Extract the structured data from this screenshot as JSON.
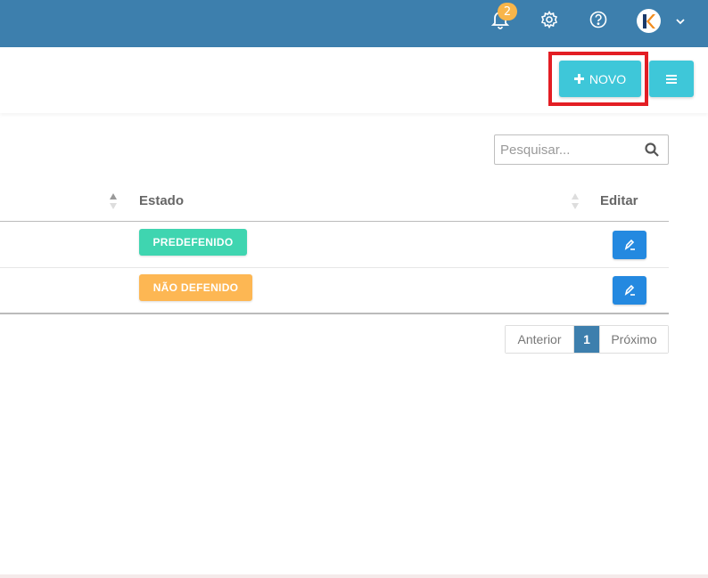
{
  "topbar": {
    "notifications_count": "2",
    "icons": [
      "bell-icon",
      "gear-icon",
      "help-icon",
      "chevron-down-icon"
    ],
    "avatar_letter": "K"
  },
  "toolbar": {
    "new_label": "NOVO",
    "new_icon": "plus-icon",
    "menu_icon": "hamburger-icon"
  },
  "search": {
    "placeholder": "Pesquisar..."
  },
  "table": {
    "columns": [
      "Estado",
      "Editar"
    ],
    "rows": [
      {
        "status": "PREDEFENIDO",
        "status_color": "#3fd5b0"
      },
      {
        "status": "NÃO DEFENIDO",
        "status_color": "#fdb753"
      }
    ]
  },
  "pagination": {
    "prev": "Anterior",
    "current": "1",
    "next": "Próximo"
  },
  "colors": {
    "topbar": "#3d7fad",
    "accent": "#3ec7d9",
    "edit": "#2489e0",
    "highlight": "#e31e24"
  }
}
